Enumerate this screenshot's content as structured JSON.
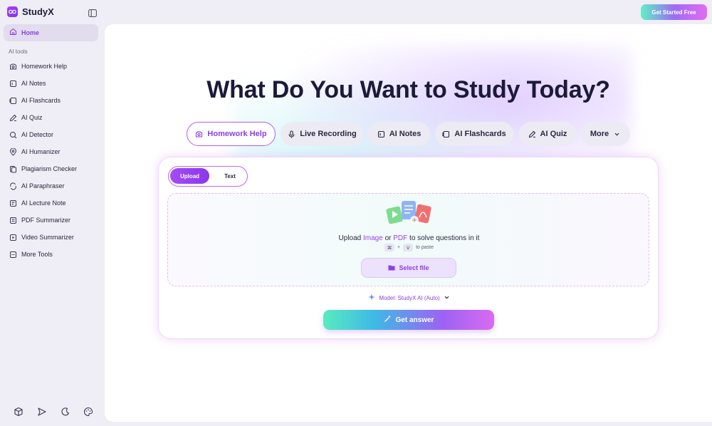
{
  "brand": {
    "name": "StudyX"
  },
  "header": {
    "cta_label": "Get Started Free"
  },
  "sidebar": {
    "home_label": "Home",
    "section_label": "AI tools",
    "items": [
      {
        "label": "Homework Help",
        "icon": "camera-icon"
      },
      {
        "label": "AI Notes",
        "icon": "notes-icon"
      },
      {
        "label": "AI Flashcards",
        "icon": "flashcards-icon"
      },
      {
        "label": "AI Quiz",
        "icon": "quiz-icon"
      },
      {
        "label": "AI Detector",
        "icon": "detector-icon"
      },
      {
        "label": "AI Humanizer",
        "icon": "humanizer-icon"
      },
      {
        "label": "Plagiarism Checker",
        "icon": "plagiarism-icon"
      },
      {
        "label": "AI Paraphraser",
        "icon": "paraphraser-icon"
      },
      {
        "label": "AI Lecture Note",
        "icon": "lecture-note-icon"
      },
      {
        "label": "PDF Summarizer",
        "icon": "pdf-icon"
      },
      {
        "label": "Video Summarizer",
        "icon": "video-icon"
      },
      {
        "label": "More Tools",
        "icon": "more-tools-icon"
      }
    ],
    "footer_icons": [
      "cube-icon",
      "send-icon",
      "moon-icon",
      "palette-icon"
    ]
  },
  "main": {
    "headline": "What Do You Want to Study Today?",
    "tabs": [
      {
        "label": "Homework Help",
        "active": true
      },
      {
        "label": "Live Recording"
      },
      {
        "label": "AI Notes"
      },
      {
        "label": "AI Flashcards"
      },
      {
        "label": "AI Quiz"
      },
      {
        "label": "More"
      }
    ],
    "mode": {
      "upload": "Upload",
      "text": "Text"
    },
    "dropzone": {
      "prefix": "Upload ",
      "image": "Image",
      "or": " or ",
      "pdf": "PDF",
      "suffix": " to solve questions in it",
      "key1": "⌘",
      "plus": "+",
      "key2": "V",
      "paste": "to paste",
      "select_label": "Select file"
    },
    "model_label": "Model: StudyX AI (Auto)",
    "submit_label": "Get answer"
  },
  "colors": {
    "accent": "#8a3fe6",
    "brand_gradient": [
      "#5ef2c4",
      "#9c6cf5",
      "#e46bf2"
    ]
  }
}
